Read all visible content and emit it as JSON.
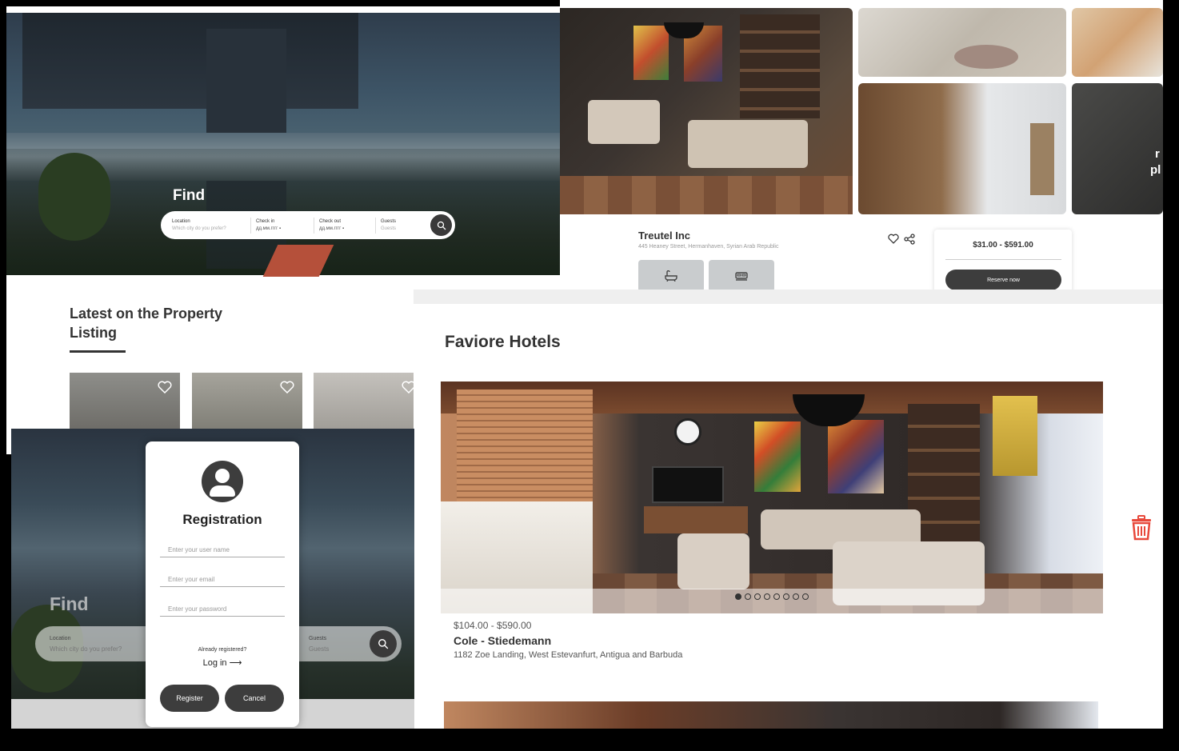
{
  "search": {
    "title": "Find",
    "location_label": "Location",
    "location_placeholder": "Which city do you prefer?",
    "checkin_label": "Check in",
    "checkin_value": "дд.мм.гггг",
    "checkout_label": "Check out",
    "checkout_value": "дд.мм.гггг",
    "guests_label": "Guests",
    "guests_placeholder": "Guests"
  },
  "listing": {
    "title": "Latest on the Property Listing"
  },
  "property": {
    "name": "Treutel Inc",
    "address": "445 Heaney Street, Hermanhaven, Syrian Arab Republic",
    "price_range": "$31.00 - $591.00",
    "reserve_label": "Reserve now",
    "side_text_1": "r",
    "side_text_2": "pl"
  },
  "favorites": {
    "title": "Faviore Hotels",
    "hotel": {
      "price": "$104.00 - $590.00",
      "name": "Cole - Stiedemann",
      "address": "1182 Zoe Landing, West Estevanfurt, Antigua and Barbuda"
    },
    "carousel_dots": 8,
    "active_dot": 0
  },
  "registration": {
    "title": "Registration",
    "username_placeholder": "Enter your user name",
    "email_placeholder": "Enter your email",
    "password_placeholder": "Enter your password",
    "already_text": "Already registered?",
    "login_label": "Log in",
    "register_label": "Register",
    "cancel_label": "Cancel"
  },
  "colors": {
    "dark_button": "#3d3d3d",
    "delete_icon": "#e8483b"
  }
}
